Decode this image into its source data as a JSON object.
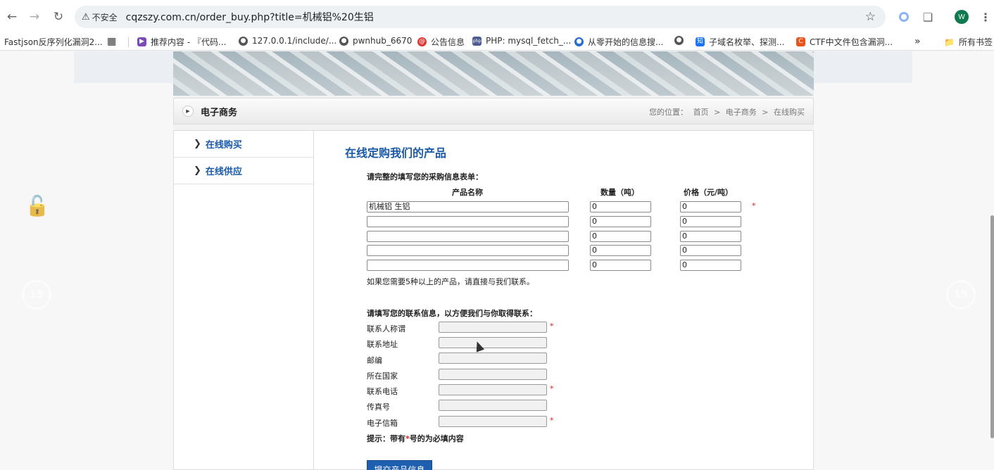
{
  "browser": {
    "insecure_label": "不安全",
    "url": "cqzszy.com.cn/order_buy.php?title=机械铝%20生铝",
    "avatar_letter": "W",
    "bookmarks": [
      {
        "label": "Fastjson反序列化漏洞2...",
        "icon": "none"
      },
      {
        "label": "推荐内容 - 『代码...",
        "icon": "bookmark-purple-icon"
      },
      {
        "label": "127.0.0.1/include/...",
        "icon": "globe-icon"
      },
      {
        "label": "pwnhub_6670",
        "icon": "globe-icon"
      },
      {
        "label": "公告信息",
        "icon": "red-circle-icon"
      },
      {
        "label": "PHP: mysql_fetch_...",
        "icon": "php-icon"
      },
      {
        "label": "从零开始的信息搜...",
        "icon": "blue-circle-icon"
      },
      {
        "label": "",
        "icon": "globe-icon"
      },
      {
        "label": "子域名枚举、探测...",
        "icon": "zhihu-icon"
      },
      {
        "label": "CTF中文件包含漏洞...",
        "icon": "c-icon"
      }
    ],
    "all_bookmarks": "所有书签",
    "more": "»"
  },
  "page": {
    "section_title": "电子商务",
    "breadcrumb": {
      "prefix": "您的位置：",
      "home": "首页",
      "sep": ">",
      "section": "电子商务",
      "current": "在线购买"
    },
    "nav": [
      {
        "label": "在线购买"
      },
      {
        "label": "在线供应"
      }
    ],
    "heading": "在线定购我们的产品",
    "form_intro": "请完整的填写您的采购信息表单：",
    "col_product": "产品名称",
    "col_qty": "数量（吨）",
    "col_price": "价格（元/吨）",
    "rows": [
      {
        "product": "机械铝 生铝",
        "qty": "0",
        "price": "0"
      },
      {
        "product": "",
        "qty": "0",
        "price": "0"
      },
      {
        "product": "",
        "qty": "0",
        "price": "0"
      },
      {
        "product": "",
        "qty": "0",
        "price": "0"
      },
      {
        "product": "",
        "qty": "0",
        "price": "0"
      }
    ],
    "more_note": "如果您需要5种以上的产品，请直接与我们联系。",
    "contact_intro": "请填写您的联系信息，以方便我们与你取得联系：",
    "contact_fields": [
      {
        "label": "联系人称谓",
        "required": true
      },
      {
        "label": "联系地址",
        "required": false
      },
      {
        "label": "邮编",
        "required": false
      },
      {
        "label": "所在国家",
        "required": false
      },
      {
        "label": "联系电话",
        "required": true
      },
      {
        "label": "传真号",
        "required": false
      },
      {
        "label": "电子信箱",
        "required": true
      }
    ],
    "required_mark": "*",
    "tip_prefix": "提示：带有",
    "tip_suffix": "号的为必填内容",
    "submit_label": "提交产品信息"
  },
  "overlay": {
    "skip_label": "15"
  }
}
